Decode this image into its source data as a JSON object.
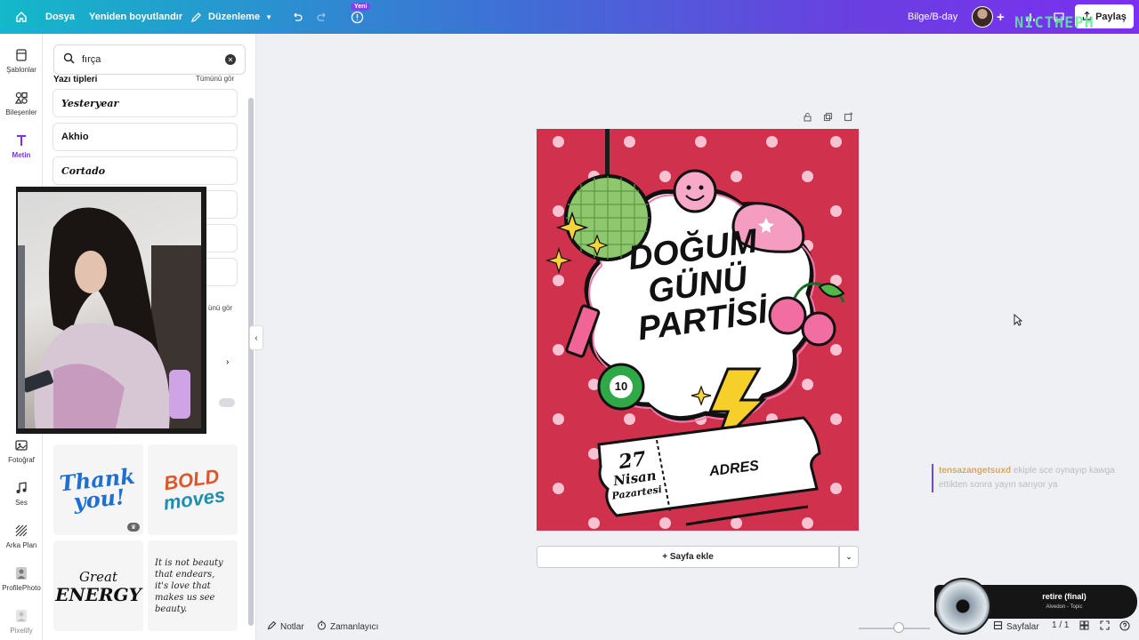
{
  "topbar": {
    "menu_file": "Dosya",
    "menu_resize": "Yeniden boyutlandır",
    "menu_edit": "Düzenleme",
    "new_badge": "Yeni",
    "project_name": "Bilge/B-day",
    "share_label": "Paylaş",
    "watermark": "NICTHEPH"
  },
  "rail": {
    "templates": "Şablonlar",
    "elements": "Bileşenler",
    "text": "Metin",
    "photos": "Fotoğraf",
    "audio": "Ses",
    "background": "Arka Plan",
    "profilephoto": "ProfilePhoto",
    "pixelify": "Pixelify"
  },
  "panel": {
    "search_value": "fırça",
    "fonts_title": "Yazı tipleri",
    "see_all": "Tümünü gör",
    "see_all_2": "ünü gör",
    "fonts": [
      "Yesteryear",
      "Akhio",
      "Cortado"
    ],
    "thumbs": [
      {
        "line1": "Thank",
        "line2": "you!",
        "color": "#1f6fd1"
      },
      {
        "line1": "BOLD",
        "line2": "moves",
        "color": "#e0552a"
      },
      {
        "line1": "Great",
        "line2": "ENERGY",
        "color": "#111111"
      },
      {
        "line1": "It is not beauty that endears, it's love that makes us see beauty.",
        "line2": "",
        "color": "#222222"
      }
    ]
  },
  "design": {
    "title_line1": "DOĞUM",
    "title_line2": "GÜNÜ",
    "title_line3": "PARTİSİ",
    "ball_number": "10",
    "day": "27",
    "month": "Nisan",
    "weekday": "Pazartesi",
    "address": "ADRES",
    "bg_color": "#d0314d"
  },
  "canvas": {
    "add_page": "+ Sayfa ekle"
  },
  "bottombar": {
    "notes": "Notlar",
    "timer": "Zamanlayıcı",
    "pages": "Sayfalar",
    "page_count": "1 / 1"
  },
  "overlay": {
    "chat_user": "tensazangetsuxd",
    "chat_text": " ekiple sce oynayıp kawga ettikten sonra yayın sarıyor ya",
    "song_title": "retire (final)",
    "song_artist": "Alvedon - Topic"
  }
}
